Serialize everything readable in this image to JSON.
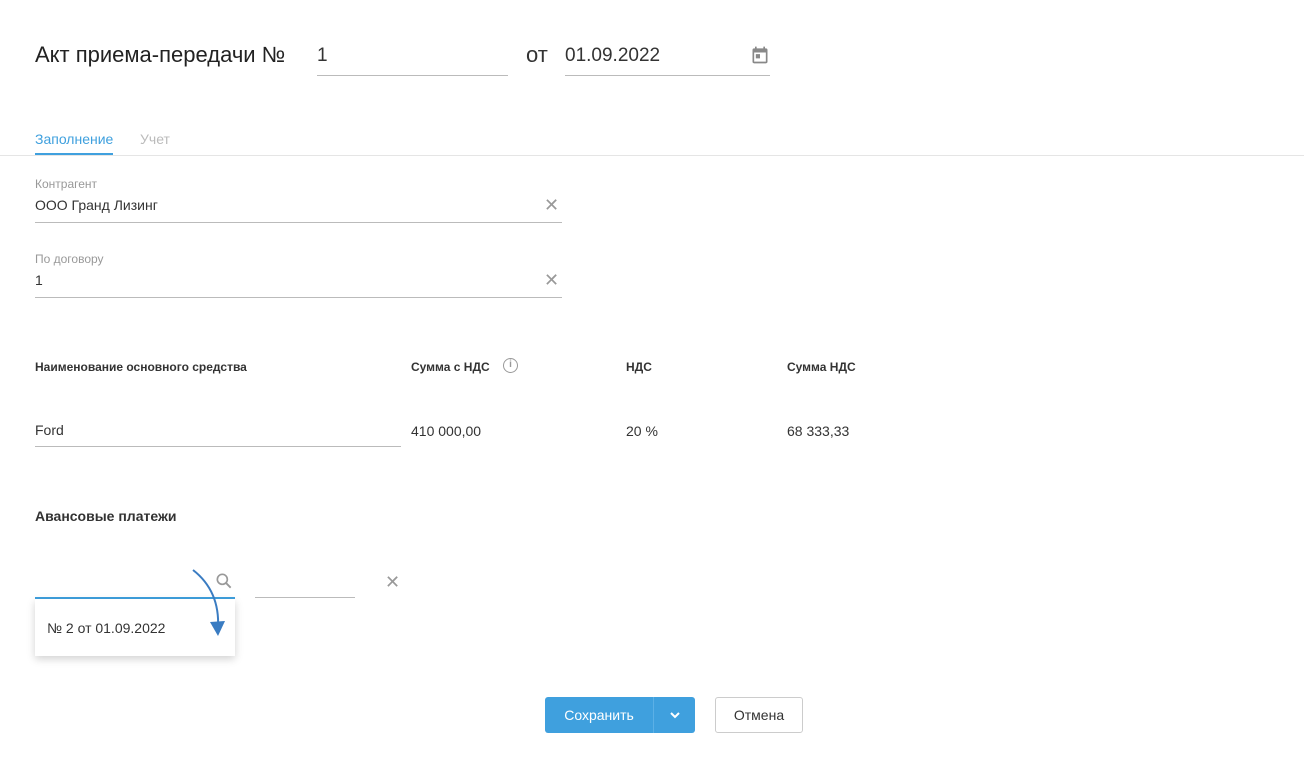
{
  "header": {
    "title": "Акт приема-передачи №",
    "number": "1",
    "from_label": "от",
    "date": "01.09.2022"
  },
  "tabs": [
    {
      "label": "Заполнение",
      "active": true
    },
    {
      "label": "Учет",
      "active": false
    }
  ],
  "fields": {
    "counterparty": {
      "label": "Контрагент",
      "value": "ООО Гранд Лизинг"
    },
    "contract": {
      "label": "По договору",
      "value": "1"
    }
  },
  "table": {
    "headers": [
      "Наименование основного средства",
      "Сумма с НДС",
      "НДС",
      "Сумма НДС"
    ],
    "row": {
      "name": "Ford",
      "sum": "410 000,00",
      "vat": "20 %",
      "vat_sum": "68 333,33"
    }
  },
  "advances": {
    "title": "Авансовые платежи",
    "dropdown_item": "№ 2 от 01.09.2022"
  },
  "buttons": {
    "save": "Сохранить",
    "cancel": "Отмена"
  },
  "colors": {
    "accent": "#3fa0de",
    "arrow": "#3a7cc2"
  }
}
